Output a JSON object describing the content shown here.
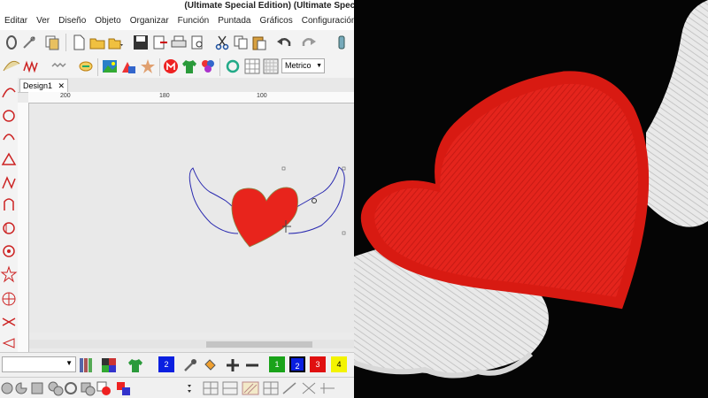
{
  "app": {
    "title": "(Ultimate Special Edition) (Ultimate Speci",
    "menu": [
      "Editar",
      "Ver",
      "Diseño",
      "Objeto",
      "Organizar",
      "Función",
      "Puntada",
      "Gráficos",
      "Configuración",
      "Ve"
    ]
  },
  "toolbar": {
    "units_select": "Metrico",
    "icons": [
      "hoop-icon",
      "needle-icon",
      "copy-design-icon",
      "new-file-icon",
      "open-folder-icon",
      "open-dropdown-icon",
      "save-icon",
      "export-icon",
      "print-icon",
      "print-preview-icon",
      "cut-icon",
      "copy-icon",
      "paste-icon",
      "undo-icon",
      "redo-icon",
      "thread-icon"
    ]
  },
  "toolbar2": {
    "icons": [
      "satin-icon",
      "zigzag-icon",
      "motif-fill-icon",
      "applique-icon",
      "image-icon",
      "shapes-icon",
      "star-icon",
      "monogram-icon",
      "tshirt-icon",
      "colors-icon",
      "wreath-icon",
      "grid-icon",
      "grid-lines-icon"
    ]
  },
  "document": {
    "tab_label": "Design1",
    "ruler_ticks": [
      "200",
      "180",
      "100"
    ]
  },
  "bottom": {
    "swatches": [
      {
        "label": "2",
        "color": "#0a1fe0",
        "text": "#ffffff"
      },
      {
        "label": "1",
        "color": "#1aa31a",
        "text": "#ffffff"
      },
      {
        "label": "2",
        "color": "#0a1fe0",
        "text": "#ffffff"
      },
      {
        "label": "3",
        "color": "#e01010",
        "text": "#ffffff"
      },
      {
        "label": "4",
        "color": "#f3f300",
        "text": "#000000"
      }
    ],
    "current_color_label": "2"
  },
  "colors": {
    "heart_red": "#e8241c",
    "wing_outline": "#2a2ab0",
    "embroidery_white": "#ececec",
    "background_black": "#050505"
  }
}
